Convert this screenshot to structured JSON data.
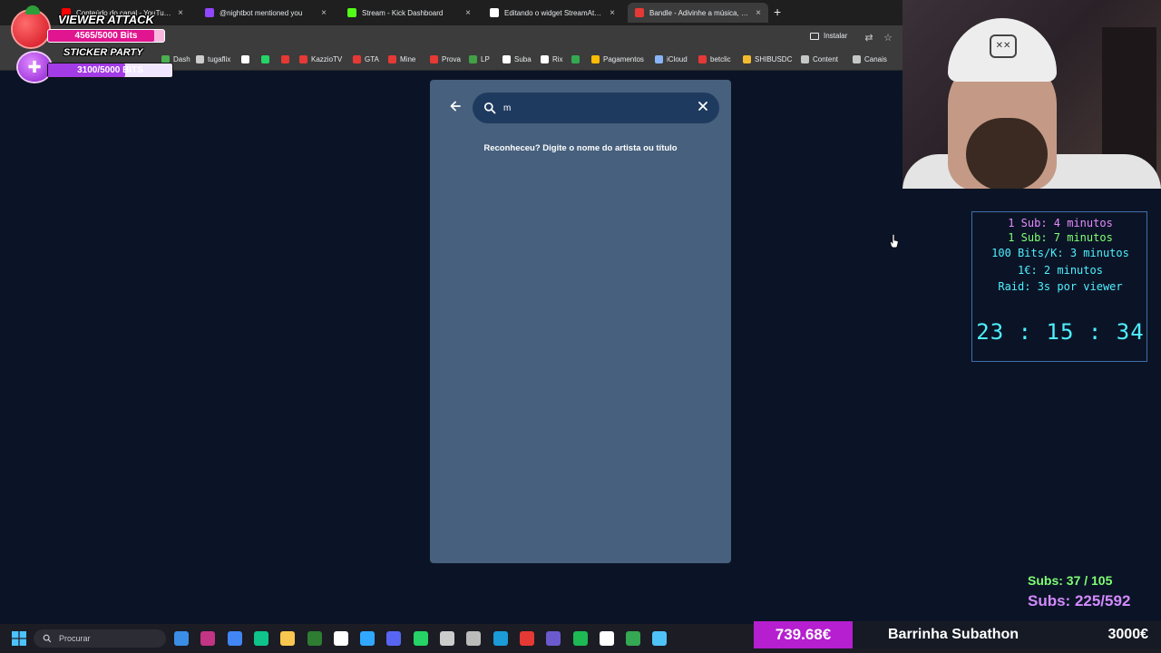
{
  "browser": {
    "tabs": [
      {
        "title": "Conteúdo do canal - YouTube S",
        "favicon_color": "#ff0000",
        "active": false
      },
      {
        "title": "@nightbot mentioned you",
        "favicon_color": "#9146ff",
        "active": false
      },
      {
        "title": "Stream - Kick Dashboard",
        "favicon_color": "#53fc18",
        "active": false
      },
      {
        "title": "Editando o widget StreamAthon",
        "favicon_color": "#ffffff",
        "active": false
      },
      {
        "title": "Bandle - Adivinhe a música, um",
        "favicon_color": "#e53935",
        "active": true
      }
    ],
    "close_glyph": "×",
    "new_tab_glyph": "+",
    "install_label": "Instalar",
    "bookmarks": [
      {
        "label": "Dash",
        "icon_color": "#4caf50"
      },
      {
        "label": "tugaflix",
        "icon_color": "#cccccc"
      },
      {
        "label": "",
        "icon_color": "#ffffff"
      },
      {
        "label": "",
        "icon_color": "#25d366"
      },
      {
        "label": "",
        "icon_color": "#e53935"
      },
      {
        "label": "KazzioTV",
        "icon_color": "#e53935"
      },
      {
        "label": "GTA",
        "icon_color": "#e53935"
      },
      {
        "label": "Mine",
        "icon_color": "#e53935"
      },
      {
        "label": "Prova",
        "icon_color": "#e53935"
      },
      {
        "label": "LP",
        "icon_color": "#43a047"
      },
      {
        "label": "Suba",
        "icon_color": "#ffffff"
      },
      {
        "label": "Rix",
        "icon_color": "#ffffff"
      },
      {
        "label": "",
        "icon_color": "#34a853"
      },
      {
        "label": "Pagamentos",
        "icon_color": "#fbbc04"
      },
      {
        "label": "iCloud",
        "icon_color": "#8ab4f8"
      },
      {
        "label": "betclic",
        "icon_color": "#e53935"
      },
      {
        "label": "SHIBUSDC",
        "icon_color": "#f3ba2f"
      },
      {
        "label": "Content",
        "icon_color": "#c4c7c5"
      },
      {
        "label": "Canais",
        "icon_color": "#c4c7c5"
      }
    ]
  },
  "overlay_bits": {
    "viewer_attack_label": "VIEWER ATTACK",
    "viewer_attack_progress": "4565/5000 Bits",
    "viewer_attack_fraction": 0.913,
    "sticker_party_label": "STICKER PARTY",
    "sticker_party_progress": "3100/5000 BITS",
    "sticker_party_fraction": 0.62
  },
  "app": {
    "search_value": "m",
    "hint": "Reconheceu? Digite o nome do artista ou título"
  },
  "timer": {
    "lines": [
      {
        "text": "1 Sub: 4 minutos",
        "color": "#e68bff"
      },
      {
        "text": "1 Sub: 7 minutos",
        "color": "#7fff74"
      },
      {
        "text": "100 Bits/K: 3 minutos",
        "color": "#4ef0ff"
      },
      {
        "text": "1€: 2 minutos",
        "color": "#4ef0ff"
      },
      {
        "text": "Raid: 3s por viewer",
        "color": "#4ef0ff"
      }
    ],
    "clock": "23 : 15 : 34"
  },
  "subs": {
    "green": "Subs: 37 / 105",
    "purple": "Subs: 225/592"
  },
  "taskbar": {
    "search_placeholder": "Procurar",
    "apps": [
      "files-icon",
      "instagram-icon",
      "chrome-icon",
      "edge-icon",
      "folder-icon",
      "calculator-icon",
      "capcut-icon",
      "photoshop-icon",
      "discord-icon",
      "whatsapp-icon",
      "epic-games-icon",
      "obs-icon",
      "steam-icon",
      "riot-icon",
      "calendar-icon",
      "spotify-icon",
      "capcut2-icon",
      "drive-icon",
      "notepad-icon"
    ],
    "app_colors": [
      "#3a8ee6",
      "#c13584",
      "#4285f4",
      "#0ec48a",
      "#f9c74f",
      "#2e7d32",
      "#ffffff",
      "#31a8ff",
      "#5865f2",
      "#25d366",
      "#cccccc",
      "#bbbbbb",
      "#1b9bd7",
      "#e53935",
      "#6a5acd",
      "#1db954",
      "#ffffff",
      "#34a853",
      "#4fc3f7"
    ]
  },
  "subathon_bar": {
    "amount": "739.68€",
    "label": "Barrinha Subathon",
    "goal": "3000€"
  }
}
